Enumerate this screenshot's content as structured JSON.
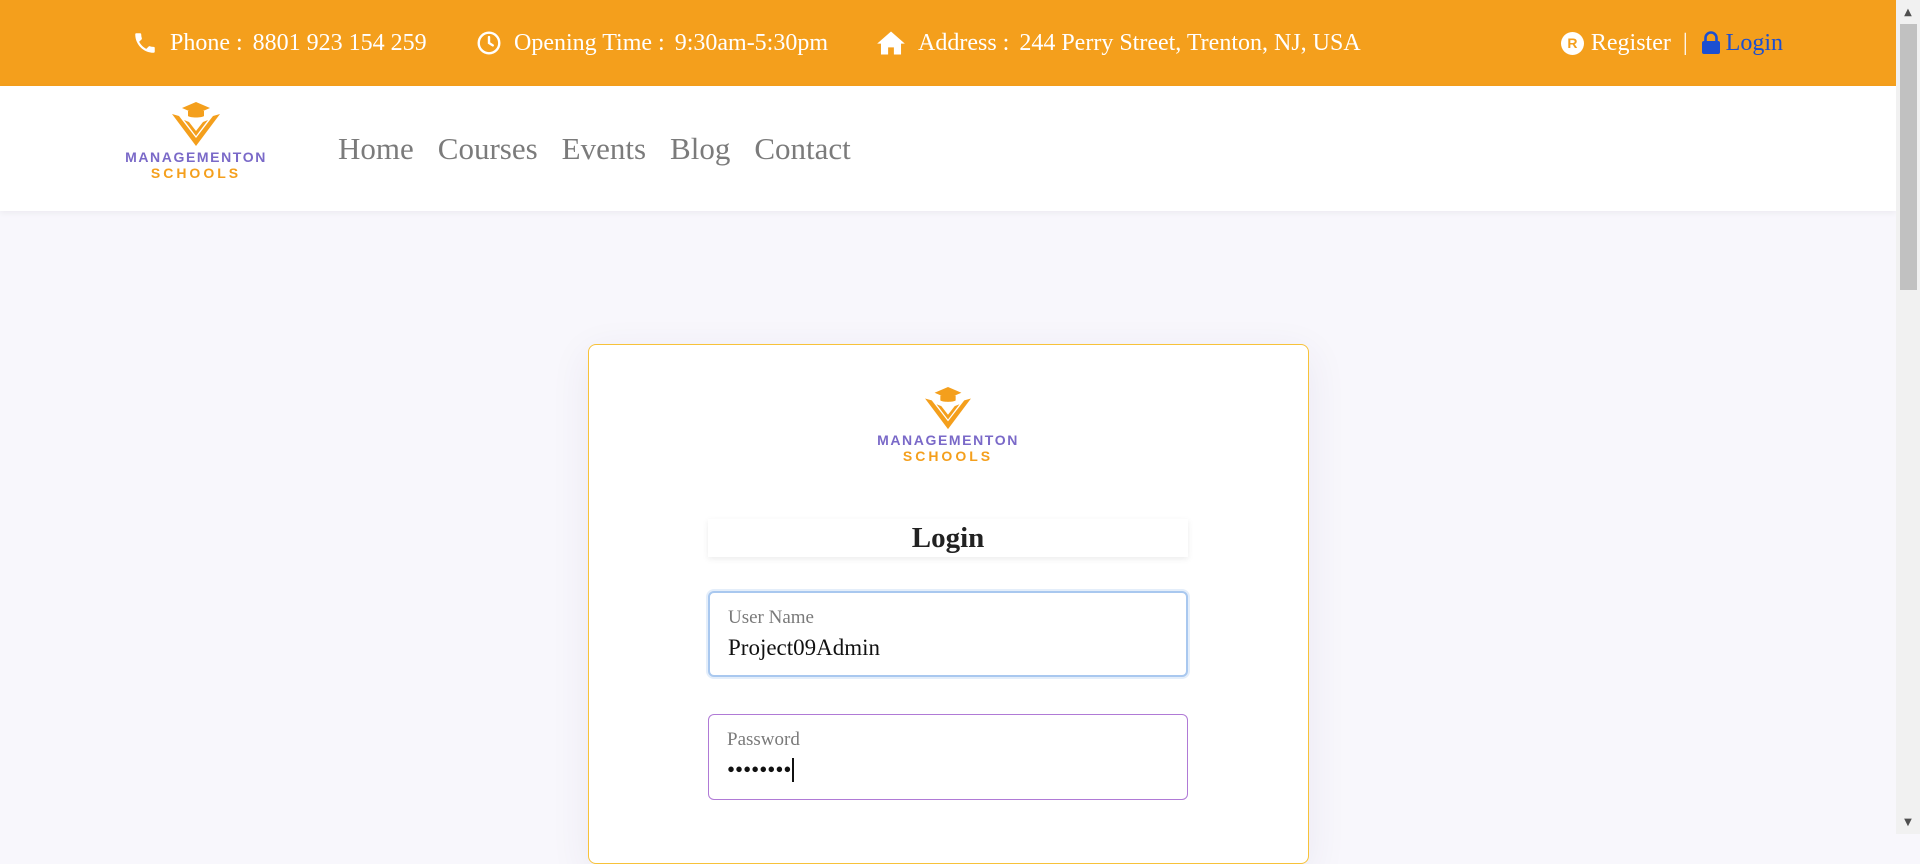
{
  "topbar": {
    "phone": {
      "icon": "phone-icon",
      "label": "Phone :",
      "value": "8801 923 154 259"
    },
    "hours": {
      "icon": "clock-icon",
      "label": "Opening Time :",
      "value": "9:30am-5:30pm"
    },
    "address": {
      "icon": "home-icon",
      "label": "Address :",
      "value": "244 Perry Street, Trenton, NJ, USA"
    },
    "register": {
      "icon": "registered-icon",
      "badge": "R",
      "label": "Register"
    },
    "separator": "|",
    "login": {
      "icon": "lock-icon",
      "label": "Login"
    }
  },
  "brand": {
    "line1": "MANAGEMENTON",
    "line2": "SCHOOLS"
  },
  "nav": {
    "items": [
      {
        "label": "Home"
      },
      {
        "label": "Courses"
      },
      {
        "label": "Events"
      },
      {
        "label": "Blog"
      },
      {
        "label": "Contact"
      }
    ]
  },
  "login_form": {
    "title": "Login",
    "username": {
      "label": "User Name",
      "value": "Project09Admin"
    },
    "password": {
      "label": "Password",
      "value": "••••••••"
    }
  },
  "colors": {
    "accent": "#f49f1c",
    "brand_purple": "#7a69c8",
    "login_link": "#1b4fd1"
  }
}
